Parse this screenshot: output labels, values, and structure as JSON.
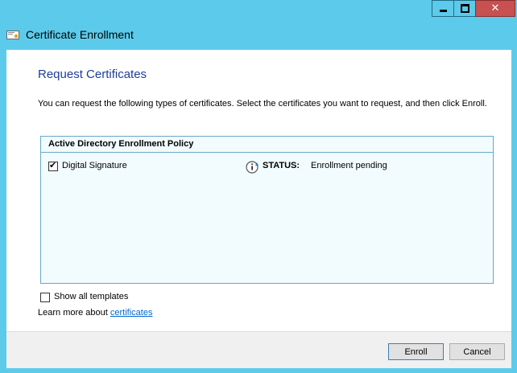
{
  "window": {
    "title": "Certificate Enrollment",
    "close_glyph": "✕"
  },
  "page": {
    "title": "Request Certificates",
    "description": "You can request the following types of certificates. Select the certificates you want to request, and then click Enroll."
  },
  "policy": {
    "header": "Active Directory Enrollment Policy",
    "items": [
      {
        "label": "Digital Signature",
        "checked": true,
        "status_label": "STATUS:",
        "status_value": "Enrollment pending",
        "status_icon": "info-icon"
      }
    ]
  },
  "options": {
    "show_all_label": "Show all templates",
    "show_all_checked": false,
    "learn_more_prefix": "Learn more about ",
    "learn_more_link": "certificates"
  },
  "buttons": {
    "enroll": "Enroll",
    "cancel": "Cancel"
  },
  "colors": {
    "frame": "#5ccbeb",
    "title_blue": "#1f3d99",
    "close_red": "#c75050",
    "link": "#0066cc"
  }
}
